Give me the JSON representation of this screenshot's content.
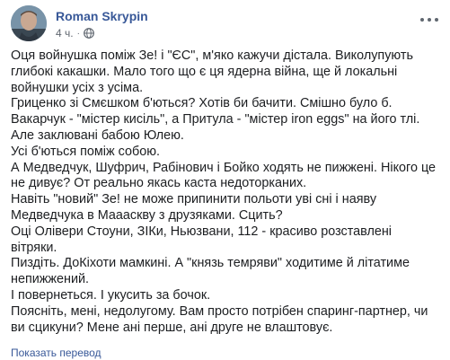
{
  "post": {
    "author": "Roman Skrypin",
    "timestamp": "4 ч.",
    "separator": "·",
    "privacy_icon": "globe-icon",
    "menu_icon": "more-options-icon",
    "paragraphs": [
      "Оця войнушка поміж Зе! і \"ЄС\", м'яко кажучи дістала. Виколупують глибокі какашки. Мало того що є ця ядерна війна, ще й локальні войнушки усіх з усіма.",
      "Гриценко зі Смєшком б'ються? Хотів би бачити. Смішно було б.",
      "Вакарчук - \"містер кисіль\", а Притула - \"містер iron eggs\" на його тлі. Але заклювані бабою Юлею.",
      "Усі б'ються поміж собою.",
      "А Медведчук, Шуфрич, Рабінович і Бойко ходять не пижжені. Нікого це не дивує? От реально якась каста недоторканих.",
      "Навіть \"новий\" Зе! не може припинити польоти уві сні і наяву Медведчука в Маааскву з друзяками. Сцить?",
      "Оці Олівери Стоуни, ЗІКи, Ньюзвани, 112 - красиво розставлені вітряки.",
      "Пиздіть. ДоКіхоти мамкині. А \"князь темряви\" ходитиме й літатиме непижжений.",
      "І повернеться. І укусить за бочок.",
      "Поясніть, мені, недолугому. Вам просто потрібен спаринг-партнер, чи ви сцикуни? Мене ані перше, ані друге не влаштовує."
    ],
    "see_translation": "Показать перевод"
  },
  "colors": {
    "author": "#385898",
    "meta": "#606770",
    "text": "#1c1e21",
    "link": "#385898"
  }
}
